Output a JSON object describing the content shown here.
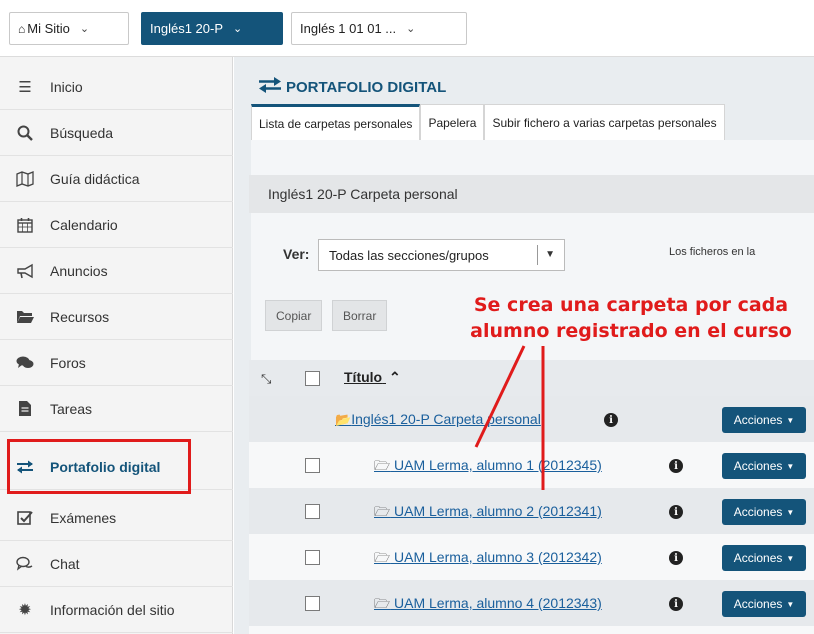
{
  "topbar": {
    "site_label": "Mi Sitio",
    "course_label": "Inglés1 20-P",
    "course2_label": "Inglés 1 01 01 ..."
  },
  "sidebar": {
    "items": [
      {
        "label": "Inicio",
        "icon": "list-icon"
      },
      {
        "label": "Búsqueda",
        "icon": "search-icon"
      },
      {
        "label": "Guía didáctica",
        "icon": "map-icon"
      },
      {
        "label": "Calendario",
        "icon": "calendar-icon"
      },
      {
        "label": "Anuncios",
        "icon": "megaphone-icon"
      },
      {
        "label": "Recursos",
        "icon": "folder-icon"
      },
      {
        "label": "Foros",
        "icon": "comments-icon"
      },
      {
        "label": "Tareas",
        "icon": "file-icon"
      },
      {
        "label": "Portafolio digital",
        "icon": "exchange-icon"
      },
      {
        "label": "Exámenes",
        "icon": "checkbox-icon"
      },
      {
        "label": "Chat",
        "icon": "chat-icon"
      },
      {
        "label": "Información del sitio",
        "icon": "gear-icon"
      }
    ],
    "current": "Portafolio digital"
  },
  "main": {
    "title": "PORTAFOLIO DIGITAL",
    "tabs": [
      {
        "label": "Lista de carpetas personales"
      },
      {
        "label": "Papelera"
      },
      {
        "label": "Subir fichero a varias carpetas personales"
      }
    ],
    "folder_header": "Inglés1 20-P Carpeta personal",
    "ver_label": "Ver:",
    "ver_value": "Todas las secciones/grupos",
    "info_note": "Los ficheros en la",
    "copy_label": "Copiar",
    "delete_label": "Borrar",
    "col_title": "Título",
    "root_folder": "Inglés1 20-P Carpeta personal",
    "actions_label": "Acciones",
    "rows": [
      {
        "label": "UAM Lerma, alumno 1 (2012345)"
      },
      {
        "label": "UAM Lerma, alumno 2 (2012341)"
      },
      {
        "label": "UAM Lerma, alumno 3 (2012342)"
      },
      {
        "label": "UAM Lerma, alumno 4 (2012343)"
      }
    ]
  },
  "annotation": {
    "line1": "Se crea una carpeta por cada",
    "line2": "alumno registrado en el curso",
    "color": "#e01b1b"
  },
  "colors": {
    "accent": "#14547a",
    "link": "#1a5f9c",
    "annotation": "#e01b1b"
  }
}
